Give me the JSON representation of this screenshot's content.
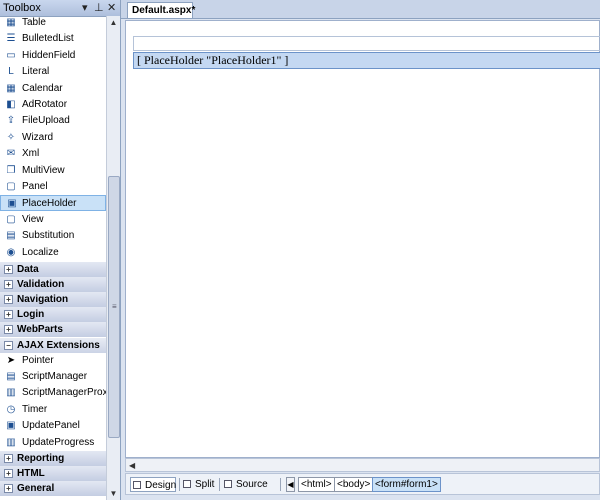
{
  "toolbox": {
    "title": "Toolbox",
    "controls": {
      "dropdown": "▾",
      "pin": "⊥",
      "close": "✕"
    },
    "standard_items": [
      {
        "label": "Table",
        "icon": "table-icon"
      },
      {
        "label": "BulletedList",
        "icon": "bulleted-list-icon"
      },
      {
        "label": "HiddenField",
        "icon": "hidden-field-icon"
      },
      {
        "label": "Literal",
        "icon": "literal-icon"
      },
      {
        "label": "Calendar",
        "icon": "calendar-icon"
      },
      {
        "label": "AdRotator",
        "icon": "ad-rotator-icon"
      },
      {
        "label": "FileUpload",
        "icon": "file-upload-icon"
      },
      {
        "label": "Wizard",
        "icon": "wizard-icon"
      },
      {
        "label": "Xml",
        "icon": "xml-icon"
      },
      {
        "label": "MultiView",
        "icon": "multiview-icon"
      },
      {
        "label": "Panel",
        "icon": "panel-icon"
      },
      {
        "label": "PlaceHolder",
        "icon": "placeholder-icon",
        "selected": true
      },
      {
        "label": "View",
        "icon": "view-icon"
      },
      {
        "label": "Substitution",
        "icon": "substitution-icon"
      },
      {
        "label": "Localize",
        "icon": "localize-icon"
      }
    ],
    "categories_collapsed_1": [
      "Data",
      "Validation",
      "Navigation",
      "Login",
      "WebParts"
    ],
    "ajax_category": "AJAX Extensions",
    "ajax_items": [
      {
        "label": "Pointer",
        "icon": "pointer-icon"
      },
      {
        "label": "ScriptManager",
        "icon": "script-manager-icon"
      },
      {
        "label": "ScriptManagerProxy",
        "icon": "script-manager-proxy-icon"
      },
      {
        "label": "Timer",
        "icon": "timer-icon"
      },
      {
        "label": "UpdatePanel",
        "icon": "update-panel-icon"
      },
      {
        "label": "UpdateProgress",
        "icon": "update-progress-icon"
      }
    ],
    "categories_collapsed_2": [
      "Reporting",
      "HTML",
      "General"
    ]
  },
  "document": {
    "tab_label": "Default.aspx*",
    "placeholder_text": "[ PlaceHolder \"PlaceHolder1\" ]"
  },
  "statusbar": {
    "views": [
      {
        "label": "Design",
        "active": true
      },
      {
        "label": "Split",
        "active": false
      },
      {
        "label": "Source",
        "active": false
      }
    ],
    "breadcrumbs": [
      "<html>",
      "<body>",
      "<form#form1>"
    ]
  }
}
